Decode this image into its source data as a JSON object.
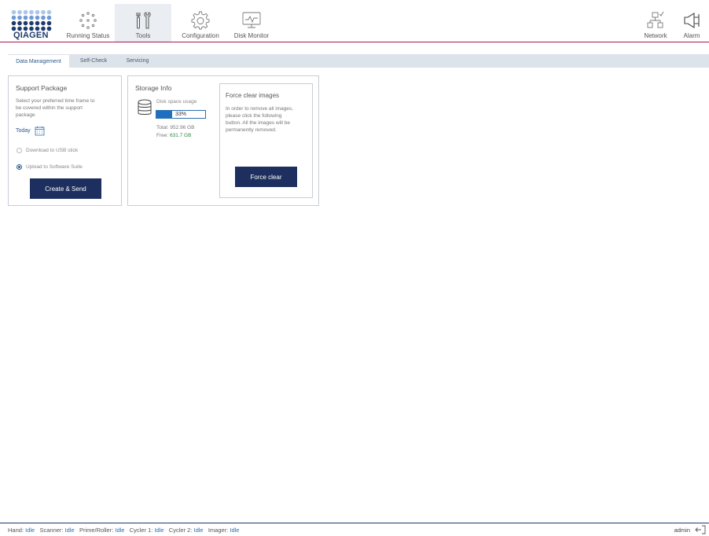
{
  "brand": {
    "name": "QIAGEN",
    "color": "#1e3a6d",
    "accent": "#b0134e"
  },
  "nav": [
    {
      "label": "Running Status",
      "icon": "running-status-icon"
    },
    {
      "label": "Tools",
      "icon": "tools-icon",
      "active": true
    },
    {
      "label": "Configuration",
      "icon": "gear-icon"
    },
    {
      "label": "Disk Monitor",
      "icon": "disk-monitor-icon"
    },
    {
      "label": "Network",
      "icon": "network-icon"
    },
    {
      "label": "Alarm",
      "icon": "alarm-icon"
    }
  ],
  "subtabs": [
    "Data Management",
    "Self-Check",
    "Servicing"
  ],
  "support": {
    "title": "Support Package",
    "desc_lines": [
      "Select your preferred time frame to",
      "be covered within the support",
      "package"
    ],
    "date": "Today",
    "options": [
      {
        "label": "Download to USB stick",
        "checked": false
      },
      {
        "label": "Upload to Software Suite",
        "checked": true
      }
    ],
    "button": "Create & Send"
  },
  "storage": {
    "title": "Storage Info",
    "usage_label": "Disk space usage",
    "usage_percent": 33,
    "usage_text": "33%",
    "total_label": "Total:",
    "total_value": "952.96 GB",
    "free_label": "Free:",
    "free_value": "631.7 GB"
  },
  "force_clear": {
    "title": "Force clear images",
    "desc_lines": [
      "In order to remove all images,",
      "please click the following",
      "button. All the images will be",
      "permanently removed."
    ],
    "button": "Force clear"
  },
  "status": [
    {
      "label": "Hand:",
      "value": "Idle"
    },
    {
      "label": "Scanner:",
      "value": "Idle"
    },
    {
      "label": "Prime/Roller:",
      "value": "Idle"
    },
    {
      "label": "Cycler 1:",
      "value": "Idle"
    },
    {
      "label": "Cycler 2:",
      "value": "Idle"
    },
    {
      "label": "Imager:",
      "value": "Idle"
    }
  ],
  "user": "admin"
}
